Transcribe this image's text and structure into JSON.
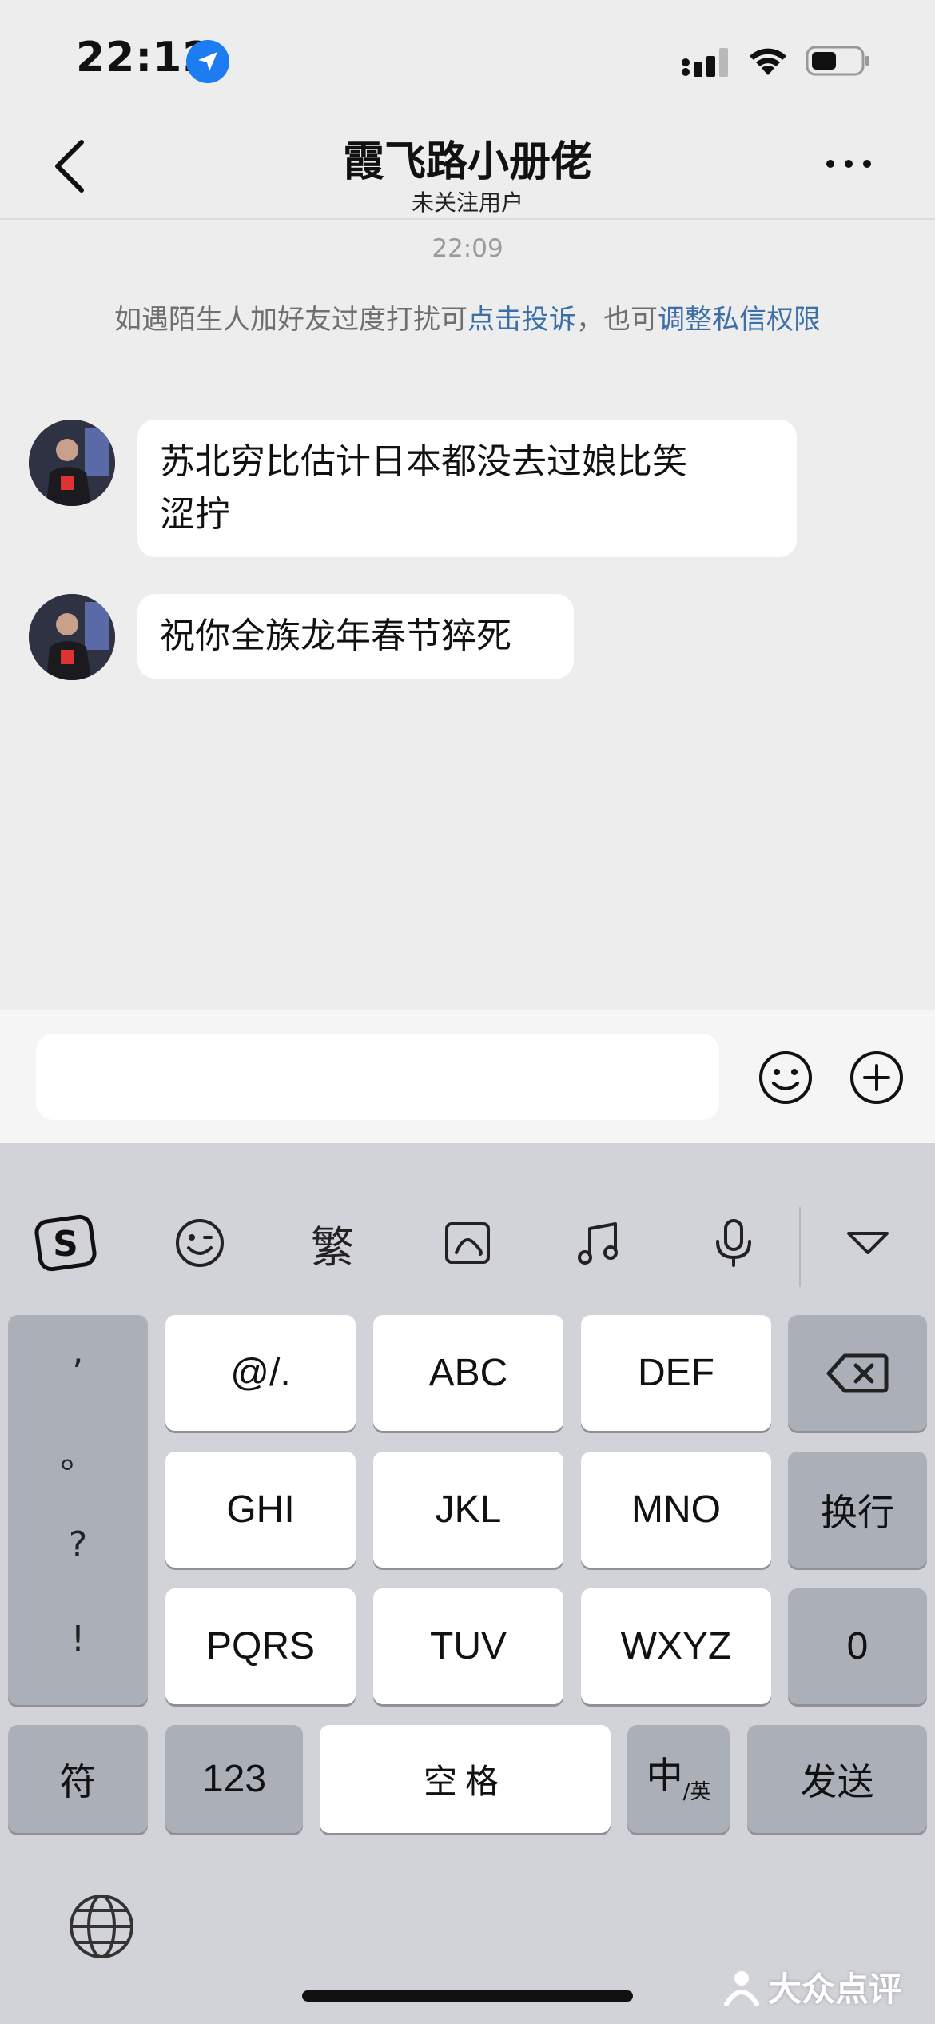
{
  "status_bar": {
    "time": "22:12"
  },
  "nav": {
    "title": "霞飞路小册佬",
    "subtitle": "未关注用户"
  },
  "chat": {
    "timestamp": "22:09",
    "notice": {
      "prefix": "如遇陌生人加好友过度打扰可",
      "complaint_link": "点击投诉",
      "middle": "，也可",
      "permission_link": "调整私信权限"
    },
    "messages": [
      {
        "line1": "苏北穷比估计日本都没去过娘比笑",
        "line2": "涩拧"
      },
      {
        "line1": "祝你全族龙年春节猝死"
      }
    ]
  },
  "input": {
    "value": "",
    "placeholder": ""
  },
  "keyboard": {
    "toolbar_fan": "繁",
    "punctuation": [
      ",",
      "。",
      "?",
      "!"
    ],
    "rows": [
      [
        "@/.",
        "ABC",
        "DEF"
      ],
      [
        "GHI",
        "JKL",
        "MNO"
      ],
      [
        "PQRS",
        "TUV",
        "WXYZ"
      ]
    ],
    "newline": "换行",
    "zero": "0",
    "symbol": "符",
    "num": "123",
    "space": "空格",
    "lang_main": "中",
    "lang_sub": "/英",
    "send": "发送"
  },
  "watermark": "大众点评",
  "colors": {
    "link": "#3c6fa8",
    "location_badge": "#1d7cf2",
    "keyboard_bg": "#d1d3d9"
  }
}
